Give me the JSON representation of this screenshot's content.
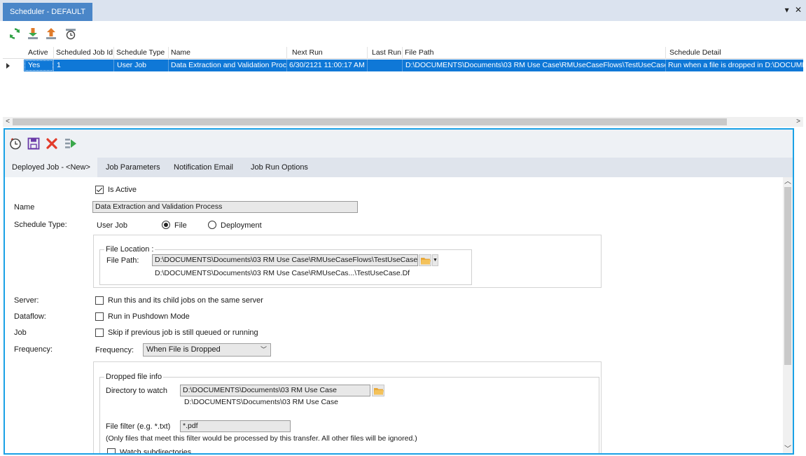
{
  "window": {
    "title": "Scheduler - DEFAULT",
    "pin_glyph": "▾",
    "close_glyph": "✕"
  },
  "toolbar": {
    "icons": [
      "refresh-icon",
      "download-icon",
      "upload-icon",
      "schedule-icon"
    ]
  },
  "grid": {
    "columns": [
      "Active",
      "Scheduled Job Id",
      "Schedule Type",
      "Name",
      "Next Run",
      "Last Run",
      "File Path",
      "Schedule Detail"
    ],
    "rows": [
      {
        "active": "Yes",
        "job_id": "1",
        "schedule_type": "User Job",
        "name": "Data Extraction and Validation Process",
        "next_run": "6/30/2121 11:00:17 AM",
        "last_run": "",
        "file_path": "D:\\DOCUMENTS\\Documents\\03 RM Use Case\\RMUseCaseFlows\\TestUseCase.Df",
        "schedule_detail": "Run when a file is dropped in D:\\DOCUMENT"
      }
    ],
    "scroll_left": "<",
    "scroll_right": ">"
  },
  "detail": {
    "tabs": [
      "Deployed Job - <New>",
      "Job Parameters",
      "Notification Email",
      "Job Run Options"
    ],
    "is_active_label": "Is Active",
    "name_label": "Name",
    "name_value": "Data Extraction and Validation Process",
    "schedule_type_label": "Schedule Type:",
    "schedule_type_value": "User Job",
    "radio_file": "File",
    "radio_deployment": "Deployment",
    "file_location_legend": "File Location :",
    "file_path_label": "File Path:",
    "file_path_value": "D:\\DOCUMENTS\\Documents\\03 RM Use Case\\RMUseCaseFlows\\TestUseCase.Df",
    "file_path_short": "D:\\DOCUMENTS\\Documents\\03 RM Use Case\\RMUseCas...\\TestUseCase.Df",
    "server_label": "Server:",
    "server_option": "Run this and its child jobs on the same server",
    "dataflow_label": "Dataflow:",
    "dataflow_option": "Run in Pushdown Mode",
    "job_label": "Job",
    "job_option": "Skip if previous job is still queued or running",
    "frequency_label": "Frequency:",
    "frequency_inner_label": "Frequency:",
    "frequency_value": "When File is Dropped",
    "dropped_legend": "Dropped file info",
    "directory_label": "Directory to watch",
    "directory_value": "D:\\DOCUMENTS\\Documents\\03 RM Use Case",
    "directory_sub": "D:\\DOCUMENTS\\Documents\\03 RM Use Case",
    "filter_label": "File filter (e.g. *.txt)",
    "filter_value": "*.pdf",
    "filter_note": "(Only files that meet this filter would be processed by this transfer. All other files will be ignored.)",
    "watch_sub_label": "Watch subdirectories"
  },
  "colors": {
    "accent": "#1aa1e6",
    "selection": "#0f78d7",
    "title_tab": "#4a86c8"
  }
}
